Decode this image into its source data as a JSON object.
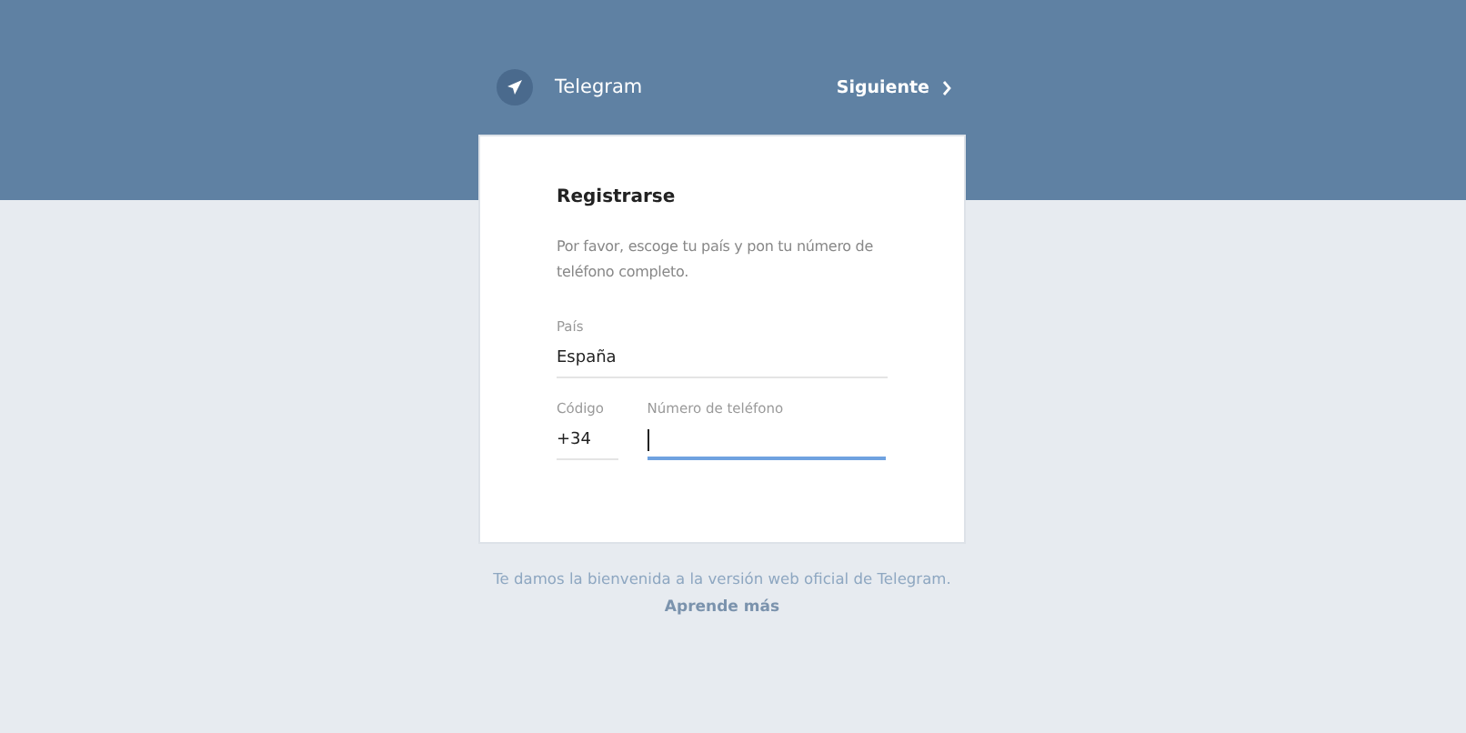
{
  "header": {
    "app_name": "Telegram",
    "next_button": "Siguiente"
  },
  "card": {
    "title": "Registrarse",
    "instructions": "Por favor, escoge tu país y pon tu número de teléfono completo.",
    "fields": [
      {
        "kind": "country",
        "label": "País",
        "value": "España",
        "focused": false
      },
      {
        "kind": "code",
        "label": "Código",
        "value": "+34",
        "focused": false
      },
      {
        "kind": "phone",
        "label": "Número de teléfono",
        "focused": true
      }
    ]
  },
  "footer": {
    "welcome": "Te damos la bienvenida a la versión web oficial de Telegram.",
    "learn_more_link": "Aprende más"
  }
}
